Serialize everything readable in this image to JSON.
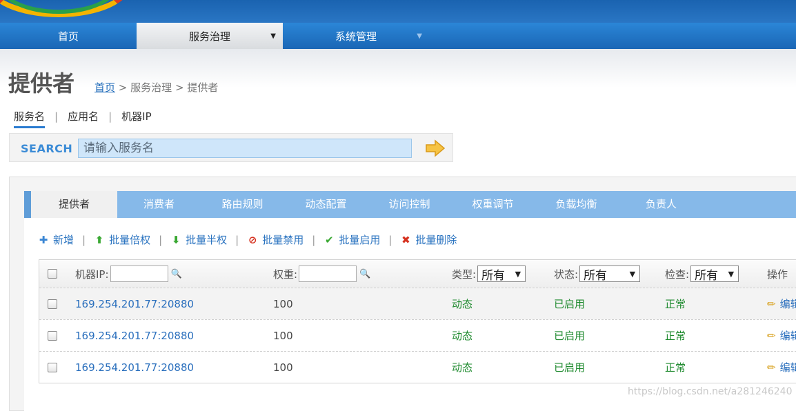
{
  "nav": {
    "items": [
      {
        "label": "首页",
        "active": false
      },
      {
        "label": "服务治理",
        "active": true,
        "arrow": "▼"
      },
      {
        "label": "系统管理",
        "active": false,
        "arrow": "▼"
      }
    ]
  },
  "page": {
    "title": "提供者",
    "breadcrumb": {
      "home": "首页",
      "sep": ">",
      "section": "服务治理",
      "current": "提供者"
    }
  },
  "search": {
    "tabs": [
      {
        "label": "服务名",
        "active": true
      },
      {
        "label": "应用名"
      },
      {
        "label": "机器IP"
      }
    ],
    "sep": "|",
    "label": "SEARCH",
    "placeholder": "请输入服务名"
  },
  "tabs": [
    "提供者",
    "消费者",
    "路由规则",
    "动态配置",
    "访问控制",
    "权重调节",
    "负载均衡",
    "负责人"
  ],
  "toolbar": {
    "sep": "|",
    "items": [
      {
        "label": "新增",
        "icon": "plus-icon",
        "color": "#3a86d4"
      },
      {
        "label": "批量倍权",
        "icon": "arrow-up-icon",
        "color": "#39a832"
      },
      {
        "label": "批量半权",
        "icon": "arrow-down-icon",
        "color": "#39a832"
      },
      {
        "label": "批量禁用",
        "icon": "ban-icon",
        "color": "#d6311f"
      },
      {
        "label": "批量启用",
        "icon": "check-icon",
        "color": "#39a832"
      },
      {
        "label": "批量删除",
        "icon": "x-icon",
        "color": "#d6311f"
      }
    ]
  },
  "table": {
    "headers": {
      "ip": "机器IP:",
      "weight": "权重:",
      "type": "类型:",
      "status": "状态:",
      "check": "检查:",
      "ops": "操作"
    },
    "filters": {
      "type": "所有",
      "status": "所有",
      "check": "所有"
    },
    "rows": [
      {
        "ip": "169.254.201.77:20880",
        "weight": "100",
        "type": "动态",
        "status": "已启用",
        "check": "正常",
        "op": "编辑"
      },
      {
        "ip": "169.254.201.77:20880",
        "weight": "100",
        "type": "动态",
        "status": "已启用",
        "check": "正常",
        "op": "编辑"
      },
      {
        "ip": "169.254.201.77:20880",
        "weight": "100",
        "type": "动态",
        "status": "已启用",
        "check": "正常",
        "op": "编辑"
      }
    ]
  },
  "watermark": "https://blog.csdn.net/a281246240"
}
